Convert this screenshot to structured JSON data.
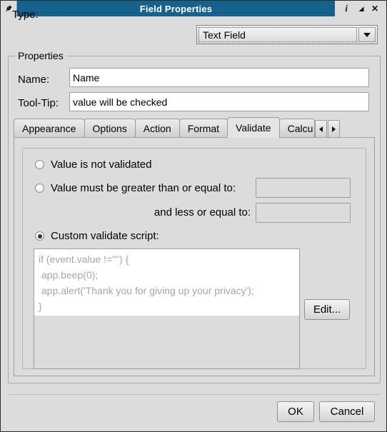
{
  "window": {
    "title": "Field Properties",
    "titlebar_color": "#15628c",
    "pin_icon": "pushpin-icon",
    "buttons": [
      {
        "name": "info-button",
        "glyph": "i"
      },
      {
        "name": "shade-button",
        "glyph": "↘"
      },
      {
        "name": "close-button",
        "glyph": "✕"
      }
    ]
  },
  "type_row": {
    "label": "Type:",
    "value": "Text Field"
  },
  "properties": {
    "legend": "Properties",
    "name_label": "Name:",
    "name_value": "Name",
    "tooltip_label": "Tool-Tip:",
    "tooltip_value": "value will be checked"
  },
  "tabs": {
    "items": [
      {
        "label": "Appearance",
        "selected": false
      },
      {
        "label": "Options",
        "selected": false
      },
      {
        "label": "Action",
        "selected": false
      },
      {
        "label": "Format",
        "selected": false
      },
      {
        "label": "Validate",
        "selected": true
      },
      {
        "label": "Calcu",
        "selected": false
      }
    ],
    "scroll_left": "◀",
    "scroll_right": "▶"
  },
  "validate": {
    "option_not_validated": "Value is not validated",
    "option_range": "Value must be greater than or equal to:",
    "and_less_label": "and less or equal to:",
    "option_custom": "Custom validate script:",
    "selected_option": "custom",
    "greater_value": "",
    "less_value": "",
    "script_lines": [
      "if (event.value !=\"\") {",
      " app.beep(0);",
      " app.alert('Thank you for giving up your privacy');",
      "}"
    ],
    "edit_label": "Edit..."
  },
  "footer": {
    "ok_label": "OK",
    "cancel_label": "Cancel"
  }
}
